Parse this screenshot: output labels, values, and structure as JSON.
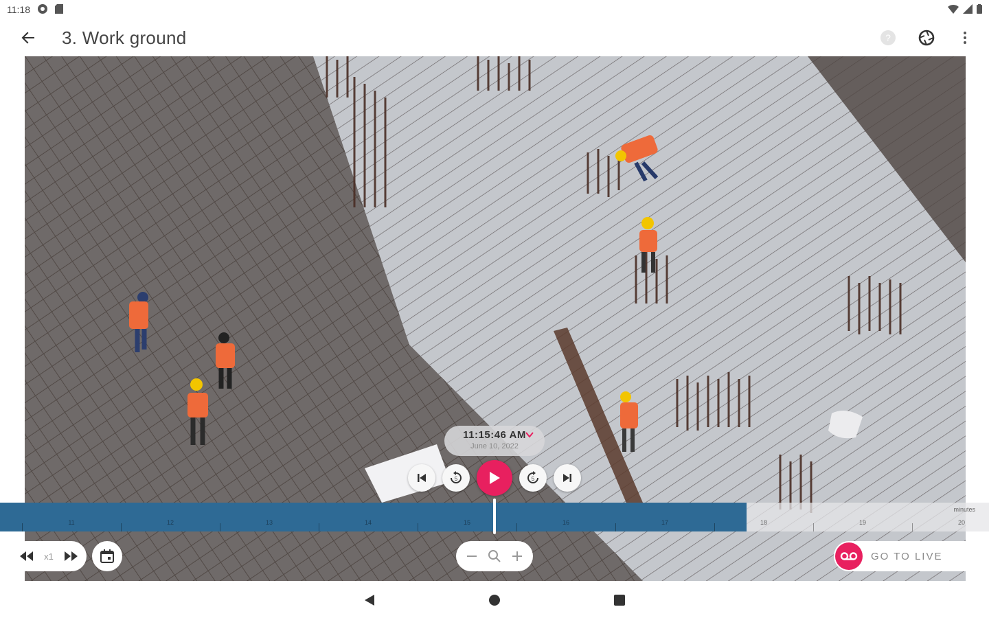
{
  "status_bar": {
    "time": "11:18"
  },
  "app_bar": {
    "title": "3. Work ground"
  },
  "player": {
    "timestamp_time": "11:15:46 AM",
    "timestamp_date": "June 10, 2022"
  },
  "timeline": {
    "unit_label": "minutes",
    "ticks": [
      "11",
      "12",
      "13",
      "14",
      "15",
      "16",
      "17",
      "18",
      "19",
      "20"
    ],
    "played_fraction": 0.755
  },
  "speed": {
    "label": "x1"
  },
  "live": {
    "label": "GO TO LIVE"
  },
  "colors": {
    "accent": "#e8205f",
    "timeline_played": "#2e6a95",
    "title_text": "#444444"
  }
}
